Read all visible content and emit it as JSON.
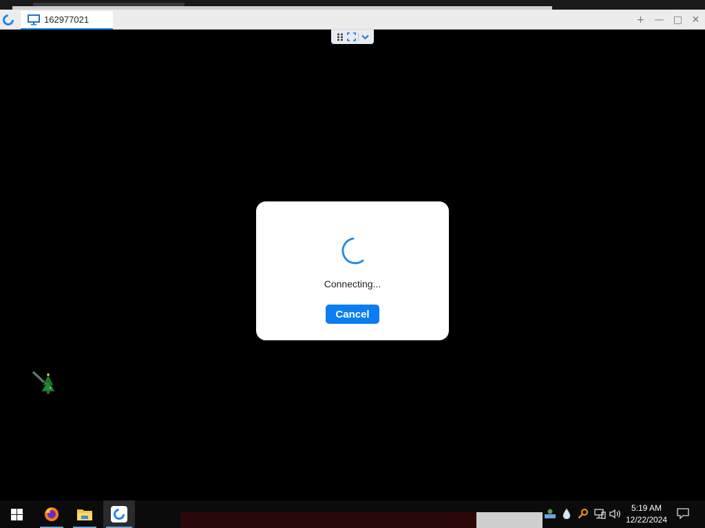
{
  "window": {
    "tab_label": "162977021",
    "controls": [
      "+",
      "—",
      "□",
      "✕"
    ]
  },
  "toolbar": {
    "icons": [
      "grid-icon",
      "fullscreen-icon",
      "chevron-down-icon"
    ]
  },
  "dialog": {
    "status_text": "Connecting...",
    "cancel_label": "Cancel"
  },
  "taskbar": {
    "apps": [
      "start-icon",
      "firefox-icon",
      "file-explorer-icon",
      "remote-desktop-app-icon"
    ],
    "tray_icons": [
      "network-user-icon",
      "drop-icon",
      "search-key-icon",
      "network-icon",
      "volume-icon"
    ],
    "time": "5:19 AM",
    "date": "12/22/2024"
  },
  "colors": {
    "accent": "#0a7ef0",
    "spinner": "#2a8be0"
  }
}
